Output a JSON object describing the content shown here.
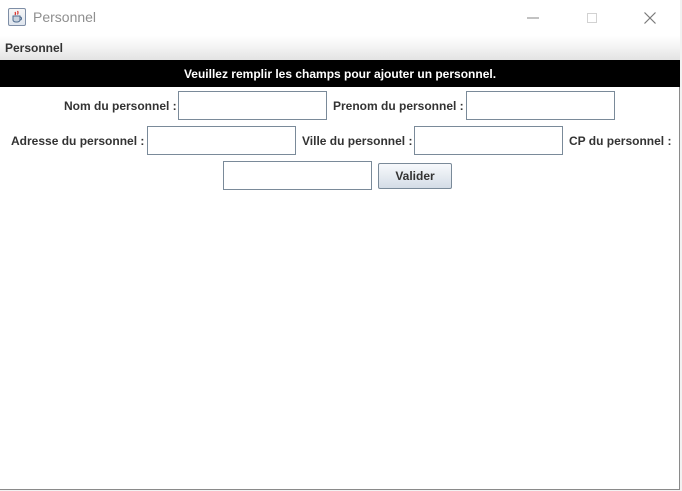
{
  "window": {
    "title": "Personnel",
    "icon": "java-cup-icon",
    "controls": [
      "minimize-icon",
      "maximize-icon",
      "close-icon"
    ]
  },
  "menubar": {
    "items": [
      "Personnel"
    ]
  },
  "banner": {
    "text": "Veuillez remplir les champs pour ajouter un personnel.",
    "background": "#000000",
    "color": "#ffffff"
  },
  "form": {
    "nom_label": "Nom du personnel :",
    "nom_value": "",
    "prenom_label": "Prenom du personnel :",
    "prenom_value": "",
    "adresse_label": "Adresse du personnel :",
    "adresse_value": "",
    "ville_label": "Ville du personnel :",
    "ville_value": "",
    "cp_label": "CP du personnel :",
    "cp_value": "",
    "submit_label": "Valider"
  }
}
